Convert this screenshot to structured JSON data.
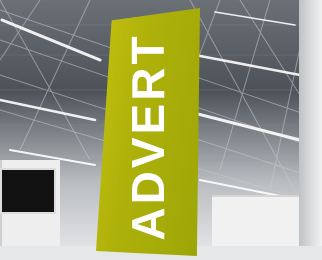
{
  "banner": {
    "text": "ADVERT",
    "color": "#b3b50b",
    "text_color": "#ffffff"
  }
}
